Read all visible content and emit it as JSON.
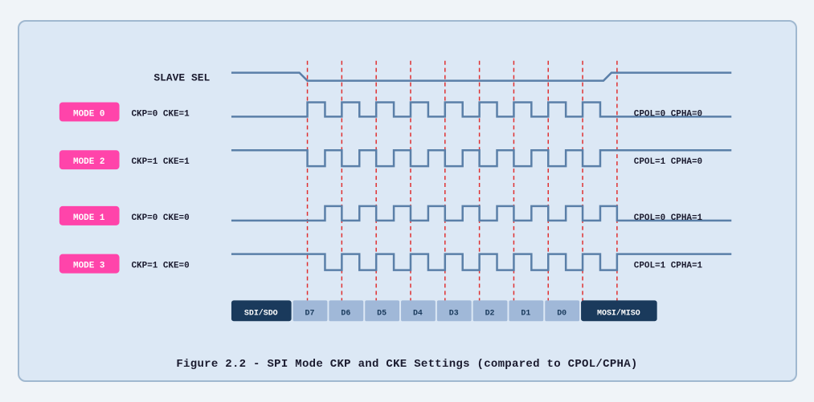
{
  "caption": "Figure 2.2 - SPI Mode CKP and CKE Settings (compared to CPOL/CPHA)",
  "diagram": {
    "slave_sel_label": "SLAVE SEL",
    "modes": [
      {
        "label": "MODE 0",
        "params": "CKP=0  CKE=1",
        "right": "CPOL=0  CPHA=0"
      },
      {
        "label": "MODE 2",
        "params": "CKP=1  CKE=1",
        "right": "CPOL=1  CPHA=0"
      },
      {
        "label": "MODE 1",
        "params": "CKP=0  CKE=0",
        "right": "CPOL=0  CPHA=1"
      },
      {
        "label": "MODE 3",
        "params": "CKP=1  CKE=0",
        "right": "CPOL=1  CPHA=1"
      }
    ],
    "data_bits": [
      "SDI/SDO",
      "D7",
      "D6",
      "D5",
      "D4",
      "D3",
      "D2",
      "D1",
      "D0",
      "MOSI/MISO"
    ]
  }
}
